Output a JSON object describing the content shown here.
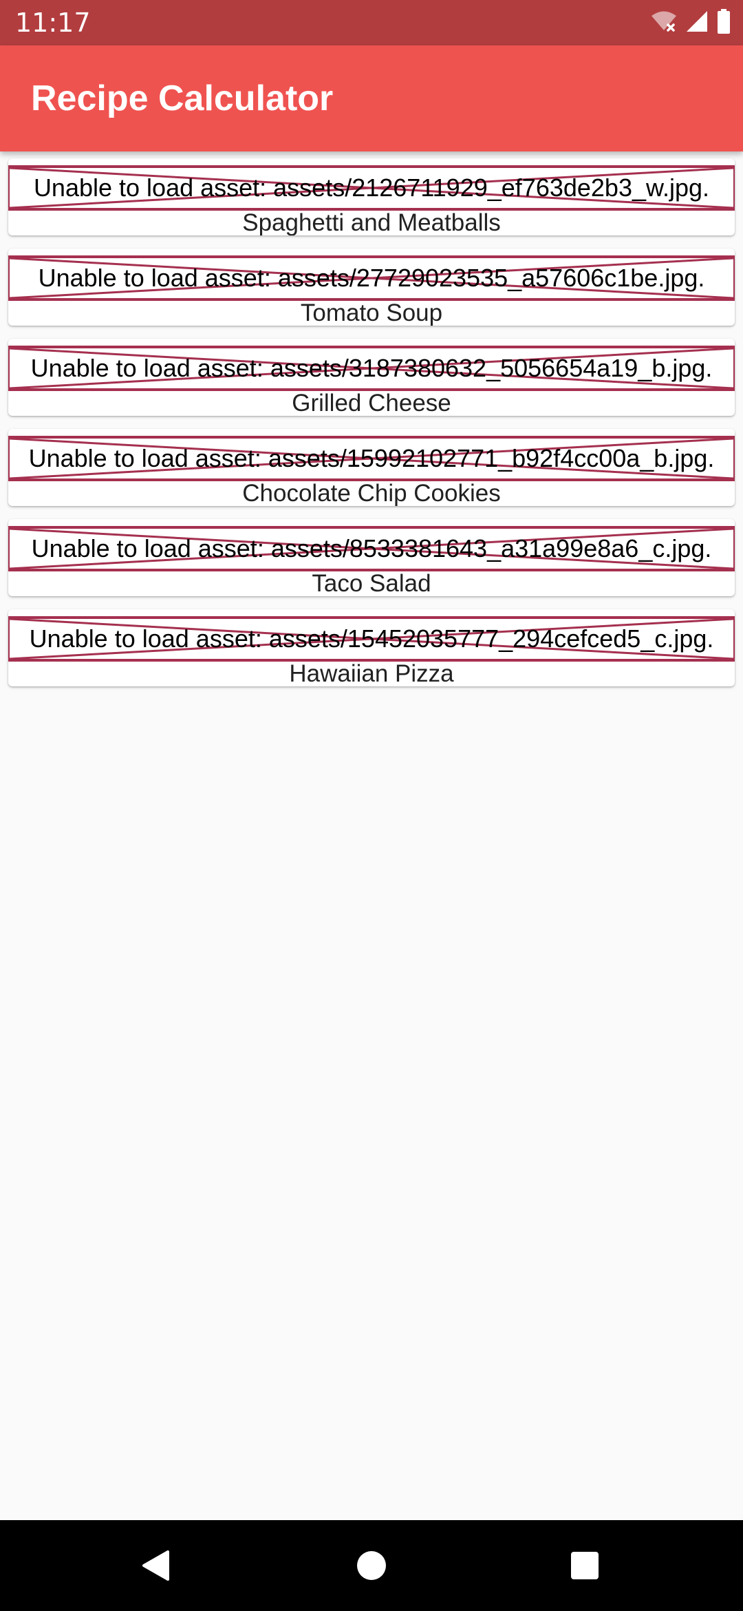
{
  "status_bar": {
    "time": "11:17",
    "icons": [
      "wifi-off-icon",
      "cell-signal-icon",
      "battery-icon"
    ]
  },
  "app_bar": {
    "title": "Recipe Calculator",
    "color": "#ef5350"
  },
  "recipes": [
    {
      "name": "Spaghetti and Meatballs",
      "image_error": "Unable to load asset: assets/2126711929_ef763de2b3_w.jpg."
    },
    {
      "name": "Tomato Soup",
      "image_error": "Unable to load asset: assets/27729023535_a57606c1be.jpg."
    },
    {
      "name": "Grilled Cheese",
      "image_error": "Unable to load asset: assets/3187380632_5056654a19_b.jpg."
    },
    {
      "name": "Chocolate Chip Cookies",
      "image_error": "Unable to load asset: assets/15992102771_b92f4cc00a_b.jpg."
    },
    {
      "name": "Taco Salad",
      "image_error": "Unable to load asset: assets/8533381643_a31a99e8a6_c.jpg."
    },
    {
      "name": "Hawaiian Pizza",
      "image_error": "Unable to load asset: assets/15452035777_294cefced5_c.jpg."
    }
  ],
  "nav_bar": {
    "buttons": [
      "back-icon",
      "home-icon",
      "recents-icon"
    ]
  },
  "colors": {
    "status_bar": "#b23d3f",
    "error_border": "#a5304f",
    "background": "#fafafa"
  }
}
